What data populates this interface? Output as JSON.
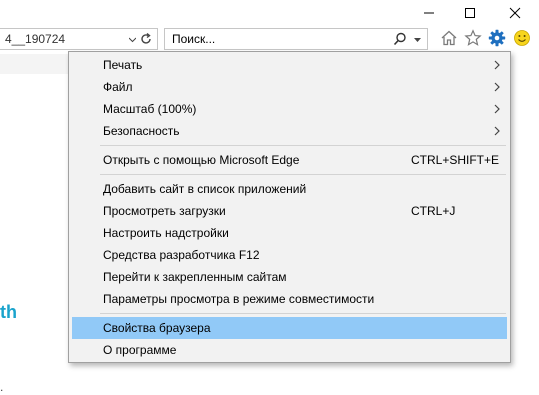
{
  "window": {
    "controls": {
      "minimize_icon": "minimize-icon",
      "maximize_icon": "maximize-icon",
      "close_icon": "close-icon"
    }
  },
  "address_bar": {
    "value": "4__190724",
    "refresh_icon": "refresh-icon",
    "dropdown_icon": "dropdown-icon"
  },
  "search": {
    "placeholder": "Поиск...",
    "search_icon": "magnifier-icon",
    "dropdown_icon": "chevron-down-icon"
  },
  "toolbar": {
    "icons": [
      "home-icon",
      "favorites-star-icon",
      "gear-icon",
      "smiley-feedback-icon"
    ],
    "accent_color": "#1e6fbf"
  },
  "page": {
    "partial_text": "th",
    "partial_text_color": "#1aa3cc",
    "bottom_text": "."
  },
  "tools_menu": {
    "groups": [
      [
        {
          "label": "Печать",
          "submenu": true
        },
        {
          "label": "Файл",
          "submenu": true
        },
        {
          "label": "Масштаб (100%)",
          "submenu": true
        },
        {
          "label": "Безопасность",
          "submenu": true
        }
      ],
      [
        {
          "label": "Открыть с помощью Microsoft Edge",
          "shortcut": "CTRL+SHIFT+E"
        }
      ],
      [
        {
          "label": "Добавить сайт в список приложений"
        },
        {
          "label": "Просмотреть загрузки",
          "shortcut": "CTRL+J"
        },
        {
          "label": "Настроить надстройки"
        },
        {
          "label": "Средства разработчика F12"
        },
        {
          "label": "Перейти к закрепленным сайтам"
        },
        {
          "label": "Параметры просмотра в режиме совместимости"
        }
      ],
      [
        {
          "label": "Свойства браузера",
          "selected": true
        },
        {
          "label": "О программе"
        }
      ]
    ],
    "highlight_color": "#91c9f7"
  }
}
